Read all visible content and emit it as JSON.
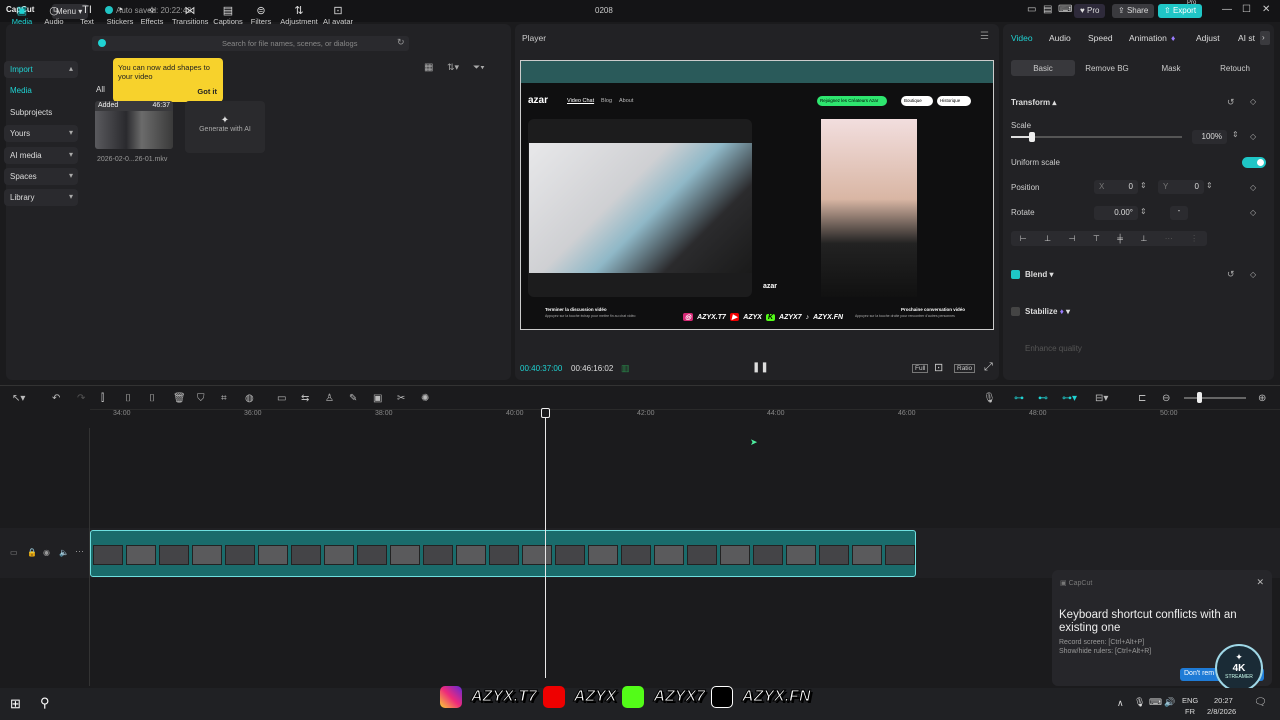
{
  "titlebar": {
    "logo": "CapCut",
    "menu": "Menu",
    "autosave": "Auto saved: 20:22:49",
    "project": "0208",
    "pro_label": "Pro",
    "share": "Share",
    "export": "Export",
    "export_badge": "Pro"
  },
  "toolbar": {
    "items": [
      "Media",
      "Audio",
      "Text",
      "Stickers",
      "Effects",
      "Transitions",
      "Captions",
      "Filters",
      "Adjustment",
      "AI avatar"
    ],
    "icons": [
      "▣",
      "◷",
      "TI",
      "◔",
      "✧",
      "⋈",
      "▤",
      "⊜",
      "⇅",
      "⊡"
    ]
  },
  "sidebar": {
    "items": [
      {
        "label": "Import",
        "chev": "▴"
      },
      {
        "label": "Media",
        "chev": ""
      },
      {
        "label": "Subprojects",
        "chev": ""
      },
      {
        "label": "Yours",
        "chev": "▾"
      },
      {
        "label": "AI media",
        "chev": "▾"
      },
      {
        "label": "Spaces",
        "chev": "▾"
      },
      {
        "label": "Library",
        "chev": "▾"
      }
    ]
  },
  "media": {
    "search_placeholder": "Search for file names, scenes, or dialogs",
    "filter_all": "All",
    "tooltip_text": "You can now add shapes to your video",
    "tooltip_btn": "Got it",
    "clip_badge": "Added",
    "clip_duration": "46:37",
    "clip_name": "2026-02-0...26-01.mkv",
    "generate_label": "Generate with AI"
  },
  "player": {
    "title": "Player",
    "current_time": "00:40:37:00",
    "total_time": "00:46:16:02",
    "full_label": "Full",
    "ratio_label": "Ratio",
    "screen": {
      "site_logo": "azar",
      "nav": [
        "Video Chat",
        "Blog",
        "About"
      ],
      "join_btn": "Rejoignez les Créateurs Azar",
      "shop_btn": "Boutique",
      "history_btn": "Historique",
      "left_caption": "Terminer la discussion vidéo",
      "left_sub": "Appuyez sur la touche échap pour mettre fin au chat vidéo",
      "right_caption": "Prochaine conversation vidéo",
      "right_sub": "Appuyez sur la touche droite pour rencontrer d'autres personnes",
      "watermark": "azar",
      "overlay": [
        "AZYX.T7",
        "AZYX",
        "AZYX7",
        "AZYX.FN"
      ]
    }
  },
  "inspector": {
    "tabs": [
      "Video",
      "Audio",
      "Speed",
      "Animation",
      "Adjust",
      "AI st"
    ],
    "subtabs": [
      "Basic",
      "Remove BG",
      "Mask",
      "Retouch"
    ],
    "transform": "Transform",
    "scale_label": "Scale",
    "scale_value": "100%",
    "scale_level": 0.12,
    "uniform_scale": "Uniform scale",
    "position_label": "Position",
    "pos_x_label": "X",
    "pos_x": "0",
    "pos_y_label": "Y",
    "pos_y": "0",
    "rotate_label": "Rotate",
    "rotate_value": "0.00°",
    "rotate_dash": "-",
    "blend": "Blend",
    "stabilize": "Stabilize",
    "enhance": "Enhance quality"
  },
  "timeline": {
    "ruler": [
      "34:00",
      "36:00",
      "38:00",
      "40:00",
      "42:00",
      "44:00",
      "46:00",
      "48:00",
      "50:00"
    ],
    "toast_app": "CapCut",
    "toast_title": "Keyboard shortcut conflicts with an existing one",
    "toast_line1": "Record screen: [Ctrl+Alt+P]",
    "toast_line2": "Show/hide rulers: [Ctrl+Alt+R]",
    "toast_btn": "Don't rem"
  },
  "taskbar": {
    "lang": "ENG",
    "lang2": "FR",
    "time": "20:27",
    "date": "2/8/2026"
  },
  "overlay_socials": [
    "AZYX.T7",
    "AZYX",
    "AZYX7",
    "AZYX.FN"
  ],
  "badge": {
    "title": "4K",
    "sub": "STREAMER"
  }
}
